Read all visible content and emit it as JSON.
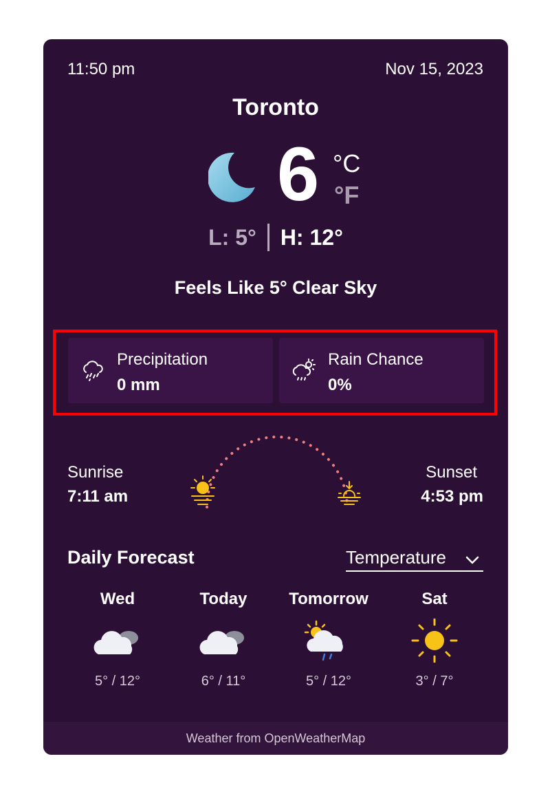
{
  "header": {
    "time": "11:50 pm",
    "date": "Nov 15, 2023"
  },
  "location": {
    "city": "Toronto"
  },
  "current": {
    "temperature": "6",
    "unit_c": "°C",
    "unit_f": "°F",
    "low": "L: 5°",
    "high": "H: 12°",
    "feels_like": "Feels Like 5° Clear Sky",
    "icon": "moon-icon"
  },
  "stats": {
    "precipitation": {
      "label": "Precipitation",
      "value": "0 mm",
      "icon": "rain-cloud-icon"
    },
    "rain_chance": {
      "label": "Rain Chance",
      "value": "0%",
      "icon": "sun-rain-cloud-icon"
    }
  },
  "sun": {
    "sunrise_label": "Sunrise",
    "sunrise_time": "7:11 am",
    "sunset_label": "Sunset",
    "sunset_time": "4:53 pm"
  },
  "daily": {
    "title": "Daily Forecast",
    "metric_selected": "Temperature",
    "days": [
      {
        "name": "Wed",
        "range": "5° / 12°",
        "icon": "cloudy-icon"
      },
      {
        "name": "Today",
        "range": "6° / 11°",
        "icon": "cloudy-icon"
      },
      {
        "name": "Tomorrow",
        "range": "5° / 12°",
        "icon": "sun-cloud-rain-icon"
      },
      {
        "name": "Sat",
        "range": "3° / 7°",
        "icon": "sun-icon"
      }
    ]
  },
  "footer": {
    "text": "Weather from OpenWeatherMap"
  },
  "colors": {
    "card_bg": "#2c0f35",
    "tile_bg": "#3a1446",
    "highlight": "#ff0000",
    "sun": "#f7c319",
    "arc": "#f08080",
    "moon": "#7ec4df"
  }
}
